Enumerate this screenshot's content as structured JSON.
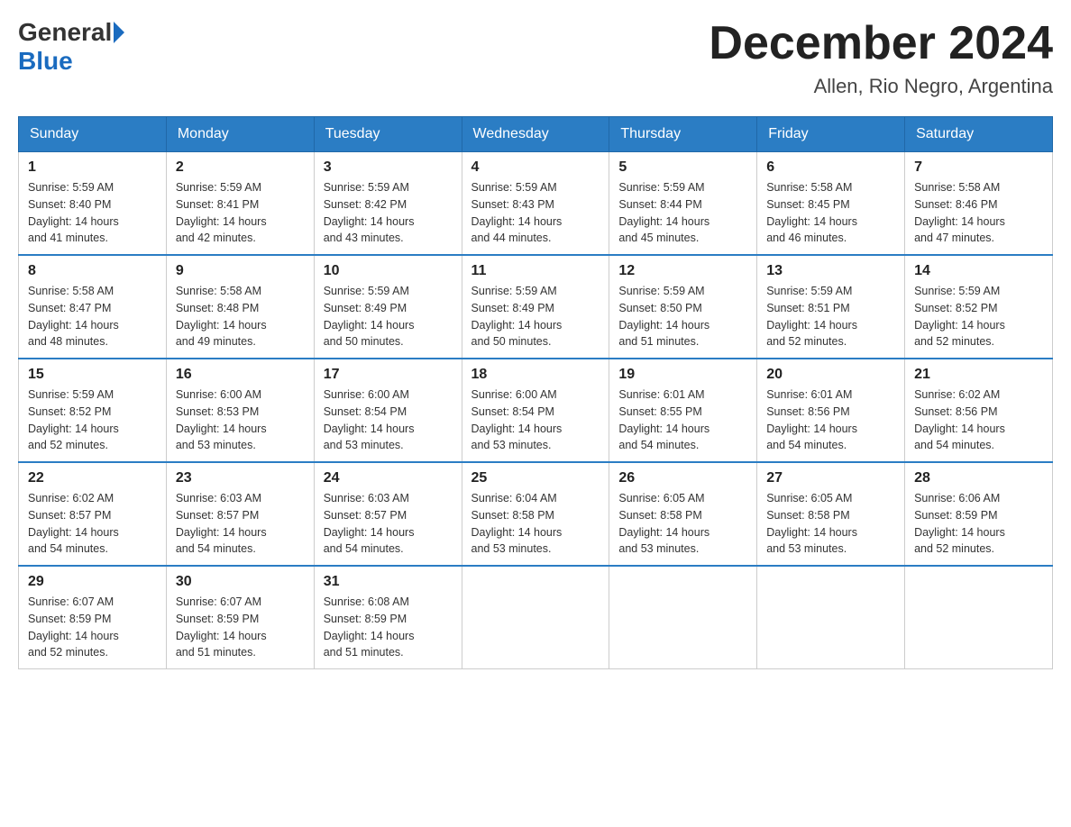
{
  "logo": {
    "general": "General",
    "blue": "Blue"
  },
  "title": "December 2024",
  "location": "Allen, Rio Negro, Argentina",
  "weekdays": [
    "Sunday",
    "Monday",
    "Tuesday",
    "Wednesday",
    "Thursday",
    "Friday",
    "Saturday"
  ],
  "weeks": [
    [
      {
        "day": "1",
        "sunrise": "5:59 AM",
        "sunset": "8:40 PM",
        "daylight": "14 hours and 41 minutes."
      },
      {
        "day": "2",
        "sunrise": "5:59 AM",
        "sunset": "8:41 PM",
        "daylight": "14 hours and 42 minutes."
      },
      {
        "day": "3",
        "sunrise": "5:59 AM",
        "sunset": "8:42 PM",
        "daylight": "14 hours and 43 minutes."
      },
      {
        "day": "4",
        "sunrise": "5:59 AM",
        "sunset": "8:43 PM",
        "daylight": "14 hours and 44 minutes."
      },
      {
        "day": "5",
        "sunrise": "5:59 AM",
        "sunset": "8:44 PM",
        "daylight": "14 hours and 45 minutes."
      },
      {
        "day": "6",
        "sunrise": "5:58 AM",
        "sunset": "8:45 PM",
        "daylight": "14 hours and 46 minutes."
      },
      {
        "day": "7",
        "sunrise": "5:58 AM",
        "sunset": "8:46 PM",
        "daylight": "14 hours and 47 minutes."
      }
    ],
    [
      {
        "day": "8",
        "sunrise": "5:58 AM",
        "sunset": "8:47 PM",
        "daylight": "14 hours and 48 minutes."
      },
      {
        "day": "9",
        "sunrise": "5:58 AM",
        "sunset": "8:48 PM",
        "daylight": "14 hours and 49 minutes."
      },
      {
        "day": "10",
        "sunrise": "5:59 AM",
        "sunset": "8:49 PM",
        "daylight": "14 hours and 50 minutes."
      },
      {
        "day": "11",
        "sunrise": "5:59 AM",
        "sunset": "8:49 PM",
        "daylight": "14 hours and 50 minutes."
      },
      {
        "day": "12",
        "sunrise": "5:59 AM",
        "sunset": "8:50 PM",
        "daylight": "14 hours and 51 minutes."
      },
      {
        "day": "13",
        "sunrise": "5:59 AM",
        "sunset": "8:51 PM",
        "daylight": "14 hours and 52 minutes."
      },
      {
        "day": "14",
        "sunrise": "5:59 AM",
        "sunset": "8:52 PM",
        "daylight": "14 hours and 52 minutes."
      }
    ],
    [
      {
        "day": "15",
        "sunrise": "5:59 AM",
        "sunset": "8:52 PM",
        "daylight": "14 hours and 52 minutes."
      },
      {
        "day": "16",
        "sunrise": "6:00 AM",
        "sunset": "8:53 PM",
        "daylight": "14 hours and 53 minutes."
      },
      {
        "day": "17",
        "sunrise": "6:00 AM",
        "sunset": "8:54 PM",
        "daylight": "14 hours and 53 minutes."
      },
      {
        "day": "18",
        "sunrise": "6:00 AM",
        "sunset": "8:54 PM",
        "daylight": "14 hours and 53 minutes."
      },
      {
        "day": "19",
        "sunrise": "6:01 AM",
        "sunset": "8:55 PM",
        "daylight": "14 hours and 54 minutes."
      },
      {
        "day": "20",
        "sunrise": "6:01 AM",
        "sunset": "8:56 PM",
        "daylight": "14 hours and 54 minutes."
      },
      {
        "day": "21",
        "sunrise": "6:02 AM",
        "sunset": "8:56 PM",
        "daylight": "14 hours and 54 minutes."
      }
    ],
    [
      {
        "day": "22",
        "sunrise": "6:02 AM",
        "sunset": "8:57 PM",
        "daylight": "14 hours and 54 minutes."
      },
      {
        "day": "23",
        "sunrise": "6:03 AM",
        "sunset": "8:57 PM",
        "daylight": "14 hours and 54 minutes."
      },
      {
        "day": "24",
        "sunrise": "6:03 AM",
        "sunset": "8:57 PM",
        "daylight": "14 hours and 54 minutes."
      },
      {
        "day": "25",
        "sunrise": "6:04 AM",
        "sunset": "8:58 PM",
        "daylight": "14 hours and 53 minutes."
      },
      {
        "day": "26",
        "sunrise": "6:05 AM",
        "sunset": "8:58 PM",
        "daylight": "14 hours and 53 minutes."
      },
      {
        "day": "27",
        "sunrise": "6:05 AM",
        "sunset": "8:58 PM",
        "daylight": "14 hours and 53 minutes."
      },
      {
        "day": "28",
        "sunrise": "6:06 AM",
        "sunset": "8:59 PM",
        "daylight": "14 hours and 52 minutes."
      }
    ],
    [
      {
        "day": "29",
        "sunrise": "6:07 AM",
        "sunset": "8:59 PM",
        "daylight": "14 hours and 52 minutes."
      },
      {
        "day": "30",
        "sunrise": "6:07 AM",
        "sunset": "8:59 PM",
        "daylight": "14 hours and 51 minutes."
      },
      {
        "day": "31",
        "sunrise": "6:08 AM",
        "sunset": "8:59 PM",
        "daylight": "14 hours and 51 minutes."
      },
      null,
      null,
      null,
      null
    ]
  ],
  "labels": {
    "sunrise": "Sunrise:",
    "sunset": "Sunset:",
    "daylight": "Daylight:"
  }
}
